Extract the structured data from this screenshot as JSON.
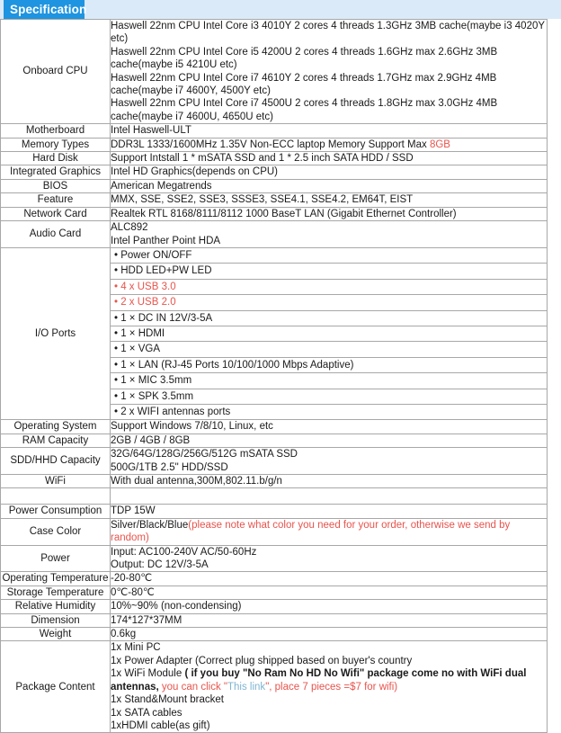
{
  "header": {
    "tab_label": "Specification",
    "tab_color": "#1f94e0",
    "band_color": "#daeaf9"
  },
  "colors": {
    "border": "#a8a8a8",
    "red_accent": "#e8544d",
    "link_blue": "#7fb5d2",
    "text": "#1a1a1a"
  },
  "table": {
    "rows": [
      {
        "key": "Onboard CPU",
        "lines": [
          "Haswell 22nm CPU Intel Core i3 4010Y 2 cores 4 threads 1.3GHz 3MB cache(maybe i3 4020Y etc)",
          "Haswell 22nm CPU Intel Core i5 4200U 2 cores 4 threads 1.6GHz max 2.6GHz 3MB cache(maybe i5 4210U etc)",
          "Haswell 22nm CPU Intel Core i7 4610Y 2 cores 4 threads 1.7GHz max 2.9GHz 4MB cache(maybe i7 4600Y, 4500Y etc)",
          "Haswell 22nm CPU Intel Core i7 4500U 2 cores 4 threads 1.8GHz max 3.0GHz 4MB cache(maybe i7 4600U, 4650U etc)"
        ]
      },
      {
        "key": "Motherboard",
        "lines": [
          "Intel Haswell-ULT"
        ]
      },
      {
        "key": "Memory Types",
        "rich": {
          "prefix": "DDR3L 1333/1600MHz 1.35V Non-ECC laptop Memory Support Max ",
          "accent": "8GB",
          "suffix": ""
        }
      },
      {
        "key": "Hard Disk",
        "lines": [
          "Support Intstall 1 * mSATA SSD and 1 * 2.5 inch SATA HDD / SSD"
        ]
      },
      {
        "key": "Integrated Graphics",
        "lines": [
          "Intel HD Graphics(depends on CPU)"
        ]
      },
      {
        "key": "BIOS",
        "lines": [
          "American Megatrends"
        ]
      },
      {
        "key": "Feature",
        "lines": [
          "MMX, SSE, SSE2, SSE3, SSSE3, SSE4.1, SSE4.2, EM64T, EIST"
        ]
      },
      {
        "key": "Network Card",
        "lines": [
          "Realtek RTL 8168/8111/8112 1000 BaseT LAN (Gigabit Ethernet Controller)"
        ]
      },
      {
        "key": "Audio Card",
        "lines": [
          "ALC892",
          "Intel Panther Point HDA"
        ]
      },
      {
        "key": "I/O Ports",
        "ports": [
          {
            "text": "• Power ON/OFF",
            "accent": false
          },
          {
            "text": "• HDD LED+PW LED",
            "accent": false
          },
          {
            "text": "• 4 x USB 3.0",
            "accent": true
          },
          {
            "text": "• 2 x USB 2.0",
            "accent": true
          },
          {
            "text": "• 1 × DC IN 12V/3-5A",
            "accent": false
          },
          {
            "text": "• 1 × HDMI",
            "accent": false
          },
          {
            "text": "• 1 × VGA",
            "accent": false
          },
          {
            "text": "• 1 × LAN (RJ-45 Ports 10/100/1000 Mbps Adaptive)",
            "accent": false
          },
          {
            "text": "• 1 × MIC 3.5mm",
            "accent": false
          },
          {
            "text": "• 1 × SPK 3.5mm",
            "accent": false
          },
          {
            "text": "• 2 x WIFI antennas ports",
            "accent": false
          }
        ]
      },
      {
        "key": "Operating System",
        "lines": [
          "Support Windows 7/8/10, Linux, etc"
        ]
      },
      {
        "key": "RAM Capacity",
        "lines": [
          "2GB / 4GB / 8GB"
        ]
      },
      {
        "key": "SDD/HHD Capacity",
        "lines": [
          "32G/64G/128G/256G/512G mSATA SSD",
          "500G/1TB 2.5\" HDD/SSD"
        ]
      },
      {
        "key": "WiFi",
        "lines": [
          "With dual antenna,300M,802.11.b/g/n"
        ]
      },
      {
        "key": "",
        "lines": [
          ""
        ]
      },
      {
        "key": "Power Consumption",
        "lines": [
          "TDP 15W"
        ]
      },
      {
        "key": "Case Color",
        "rich": {
          "prefix": "Silver/Black/Blue",
          "accent": "(please note what color you need for your order, otherwise we send by random)",
          "suffix": ""
        }
      },
      {
        "key": "Power",
        "lines": [
          "Input: AC100-240V AC/50-60Hz",
          "Output: DC 12V/3-5A"
        ]
      },
      {
        "key": "Operating Temperature",
        "lines": [
          "-20-80℃"
        ]
      },
      {
        "key": "Storage Temperature",
        "lines": [
          "0℃-80℃"
        ]
      },
      {
        "key": "Relative Humidity",
        "lines": [
          "10%~90% (non-condensing)"
        ]
      },
      {
        "key": "Dimension",
        "lines": [
          "174*127*37MM"
        ]
      },
      {
        "key": "Weight",
        "lines": [
          "0.6kg"
        ]
      },
      {
        "key": "Package Content",
        "package": {
          "line1": "1x Mini PC",
          "line2": "1x Power Adapter (Correct plug shipped based on buyer's country",
          "line3_plain": "1x WiFi Module ",
          "line3_bold": "( if you buy \"No Ram No HD No Wifi\" package come no with WiFi dual antennas,",
          "line3_red_a": " you can click \"",
          "line3_link": "This link",
          "line3_red_b": "\", place 7 pieces =$7 for wifi)",
          "line4": "1x Stand&Mount bracket",
          "line5": "1x SATA cables",
          "line6": "1xHDMI cable(as gift)"
        }
      }
    ]
  }
}
